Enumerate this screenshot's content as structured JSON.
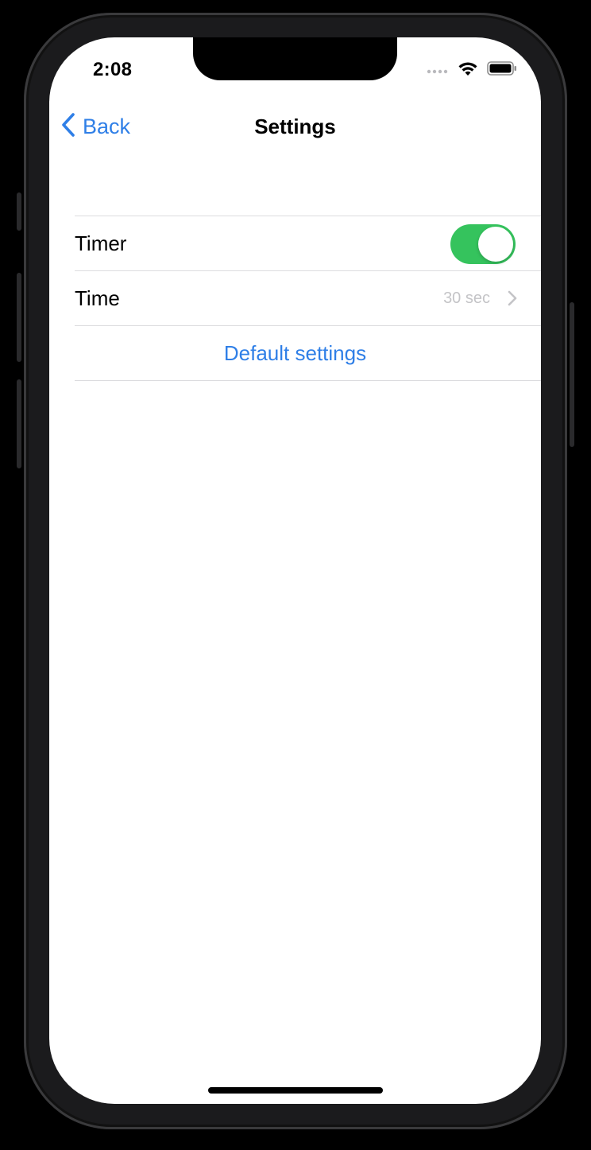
{
  "status_bar": {
    "time": "2:08"
  },
  "nav": {
    "back_label": "Back",
    "title": "Settings"
  },
  "settings": {
    "timer_label": "Timer",
    "timer_enabled": true,
    "time_label": "Time",
    "time_value": "30 sec",
    "default_settings_label": "Default settings"
  },
  "colors": {
    "accent": "#2f7fe7",
    "toggle_on": "#35c35d",
    "separator": "#dcdcdf",
    "secondary_text": "#c4c4c7"
  },
  "icons": {
    "back": "chevron-left-icon",
    "disclosure": "chevron-right-icon",
    "wifi": "wifi-icon",
    "battery": "battery-icon",
    "signal": "cellular-signal-icon"
  }
}
